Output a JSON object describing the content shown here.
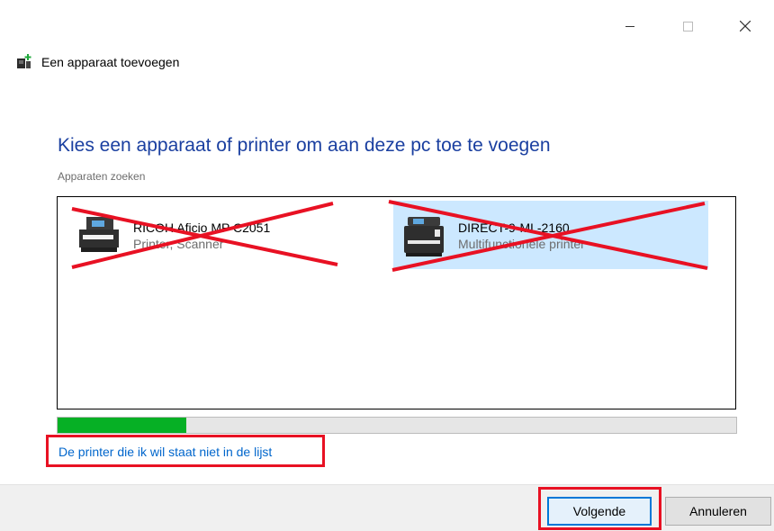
{
  "window": {
    "title": "Een apparaat toevoegen",
    "controls": {
      "minimize": "—",
      "maximize": "□",
      "close": "✕"
    }
  },
  "main": {
    "heading": "Kies een apparaat of printer om aan deze pc toe te voegen",
    "status": "Apparaten zoeken",
    "devices": [
      {
        "name": "RICOH Aficio MP C2051",
        "type": "Printer, Scanner",
        "icon": "printer-icon",
        "selected": false,
        "crossed_out": true
      },
      {
        "name": "DIRECT-9-ML-2160",
        "type": "Multifunctionele printer",
        "icon": "multifunction-printer-icon",
        "selected": true,
        "crossed_out": true
      }
    ],
    "progress_fraction": 0.19,
    "not_listed_link": "De printer die ik wil staat niet in de lijst"
  },
  "footer": {
    "next_label": "Volgende",
    "cancel_label": "Annuleren"
  },
  "colors": {
    "heading": "#1a3fa0",
    "link": "#0066cc",
    "progress": "#06b025",
    "selection": "#cce8ff",
    "highlight_red": "#e81123"
  }
}
